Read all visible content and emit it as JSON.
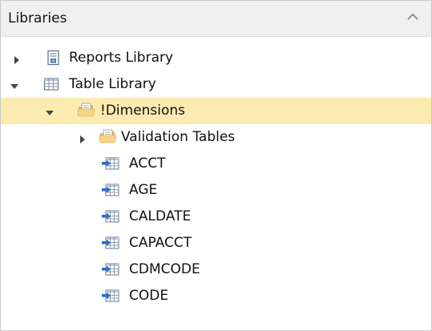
{
  "panel": {
    "title": "Libraries"
  },
  "tree": {
    "reports_library": "Reports Library",
    "table_library": "Table Library",
    "dimensions": "!Dimensions",
    "validation_tables": "Validation Tables",
    "tables": [
      "ACCT",
      "AGE",
      "CALDATE",
      "CAPACCT",
      "CDMCODE",
      "CODE"
    ]
  },
  "colors": {
    "selected_row": "#fcebb0",
    "folder": "#f2c46b",
    "table_arrow": "#2f6fc4"
  }
}
